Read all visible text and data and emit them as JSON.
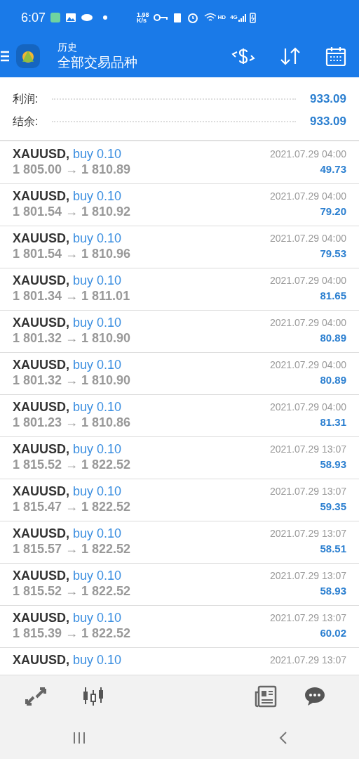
{
  "status_bar": {
    "time": "6:07",
    "net_speed": "1.98",
    "net_unit": "K/s",
    "hd": "HD",
    "network": "4G"
  },
  "header": {
    "subtitle": "历史",
    "title": "全部交易品种"
  },
  "summary": [
    {
      "label": "利润:",
      "value": "933.09"
    },
    {
      "label": "结余:",
      "value": "933.09"
    }
  ],
  "deals": [
    {
      "symbol": "XAUUSD,",
      "side": "buy 0.10",
      "time": "2021.07.29 04:00",
      "prices": "1 805.00 → 1 810.89",
      "profit": "49.73"
    },
    {
      "symbol": "XAUUSD,",
      "side": "buy 0.10",
      "time": "2021.07.29 04:00",
      "prices": "1 801.54 → 1 810.92",
      "profit": "79.20"
    },
    {
      "symbol": "XAUUSD,",
      "side": "buy 0.10",
      "time": "2021.07.29 04:00",
      "prices": "1 801.54 → 1 810.96",
      "profit": "79.53"
    },
    {
      "symbol": "XAUUSD,",
      "side": "buy 0.10",
      "time": "2021.07.29 04:00",
      "prices": "1 801.34 → 1 811.01",
      "profit": "81.65"
    },
    {
      "symbol": "XAUUSD,",
      "side": "buy 0.10",
      "time": "2021.07.29 04:00",
      "prices": "1 801.32 → 1 810.90",
      "profit": "80.89"
    },
    {
      "symbol": "XAUUSD,",
      "side": "buy 0.10",
      "time": "2021.07.29 04:00",
      "prices": "1 801.32 → 1 810.90",
      "profit": "80.89"
    },
    {
      "symbol": "XAUUSD,",
      "side": "buy 0.10",
      "time": "2021.07.29 04:00",
      "prices": "1 801.23 → 1 810.86",
      "profit": "81.31"
    },
    {
      "symbol": "XAUUSD,",
      "side": "buy 0.10",
      "time": "2021.07.29 13:07",
      "prices": "1 815.52 → 1 822.52",
      "profit": "58.93"
    },
    {
      "symbol": "XAUUSD,",
      "side": "buy 0.10",
      "time": "2021.07.29 13:07",
      "prices": "1 815.47 → 1 822.52",
      "profit": "59.35"
    },
    {
      "symbol": "XAUUSD,",
      "side": "buy 0.10",
      "time": "2021.07.29 13:07",
      "prices": "1 815.57 → 1 822.52",
      "profit": "58.51"
    },
    {
      "symbol": "XAUUSD,",
      "side": "buy 0.10",
      "time": "2021.07.29 13:07",
      "prices": "1 815.52 → 1 822.52",
      "profit": "58.93"
    },
    {
      "symbol": "XAUUSD,",
      "side": "buy 0.10",
      "time": "2021.07.29 13:07",
      "prices": "1 815.39 → 1 822.52",
      "profit": "60.02"
    },
    {
      "symbol": "XAUUSD,",
      "side": "buy 0.10",
      "time": "2021.07.29 13:07"
    }
  ]
}
